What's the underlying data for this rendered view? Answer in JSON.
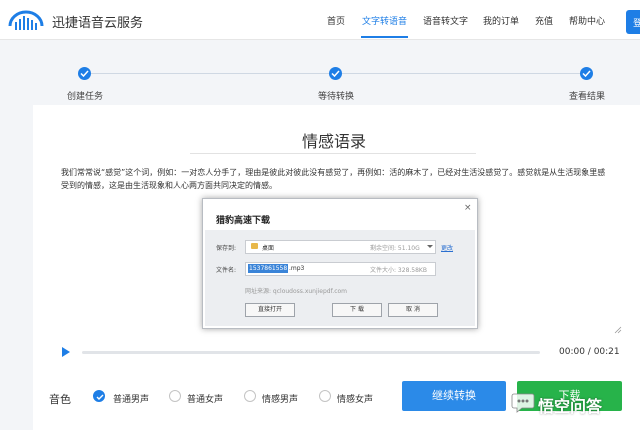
{
  "header": {
    "logo_text": "迅捷语音云服务",
    "nav": [
      "首页",
      "文字转语音",
      "语音转文字",
      "我的订单",
      "充值",
      "帮助中心"
    ],
    "active_nav": "文字转语音",
    "login_label": "登"
  },
  "steps": [
    "创建任务",
    "等待转换",
    "查看结果"
  ],
  "main": {
    "title": "情感语录",
    "body": "我们常常说“感觉”这个词，例如：一对恋人分手了，理由是彼此对彼此没有感觉了，再例如：活的麻木了，已经对生活没感觉了。感觉就是从生活现象里感受到的情感，这是由生活现象和人心两方面共同决定的情感。"
  },
  "player": {
    "time": "00:00 / 00:21",
    "progress_fraction": 0
  },
  "voice": {
    "label": "音色",
    "options": [
      "普通男声",
      "普通女声",
      "情感男声",
      "情感女声"
    ],
    "selected": "普通男声"
  },
  "buttons": {
    "continue": "继续转换",
    "download": "下载"
  },
  "dialog": {
    "title": "猎豹高速下载",
    "close": "×",
    "save_label": "保存到:",
    "save_path": "桌面",
    "free_space": "剩余空间: 51.10G",
    "change_link": "更改",
    "filename_label": "文件名:",
    "filename_selected": "1537861558",
    "filename_ext": ".mp3",
    "file_size": "文件大小: 328.58KB",
    "source": "网址来源: qcloudoss.xunjiepdf.com",
    "open_button": "直接打开",
    "download_button": "下 载",
    "cancel_button": "取 消"
  },
  "watermark": {
    "text": "悟空问答"
  },
  "colors": {
    "accent": "#1e7ee6",
    "download_green": "#27b34a",
    "continue_blue": "#2b8ae8"
  }
}
